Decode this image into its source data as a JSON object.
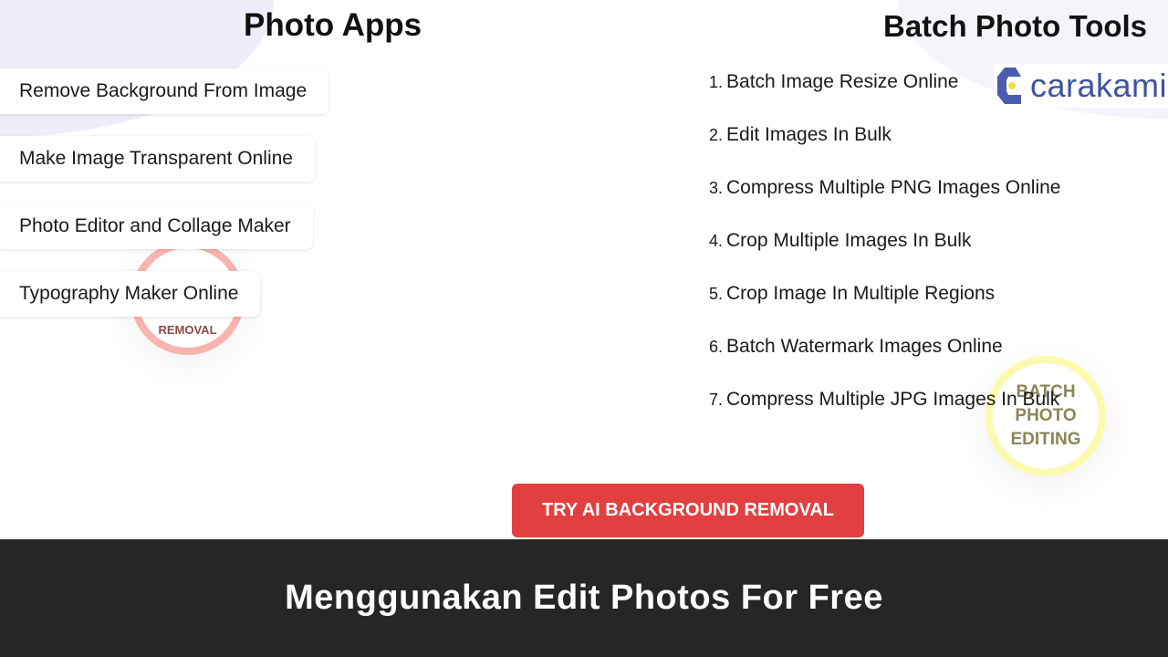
{
  "left": {
    "title": "Photo Apps",
    "items": [
      "Remove Background From Image",
      "Make Image Transparent Online",
      "Photo Editor and Collage Maker",
      "Typography Maker Online"
    ],
    "badge": "REMOVAL"
  },
  "right": {
    "title": "Batch Photo Tools",
    "items": [
      {
        "num": "1.",
        "label": "Batch Image Resize Online"
      },
      {
        "num": "2.",
        "label": "Edit Images In Bulk"
      },
      {
        "num": "3.",
        "label": "Compress Multiple PNG Images Online"
      },
      {
        "num": "4.",
        "label": "Crop Multiple Images In Bulk"
      },
      {
        "num": "5.",
        "label": "Crop Image In Multiple Regions"
      },
      {
        "num": "6.",
        "label": "Batch Watermark Images Online"
      },
      {
        "num": "7.",
        "label": "Compress Multiple JPG Images In Bulk"
      }
    ],
    "badge_lines": [
      "BATCH",
      "PHOTO",
      "EDITING"
    ]
  },
  "logo": {
    "text": "carakami",
    "color": "#3f53a0",
    "accent": "#f2e23a"
  },
  "cta": {
    "label": "TRY AI BACKGROUND REMOVAL",
    "color": "#e24040"
  },
  "banner": {
    "title": "Menggunakan Edit Photos For Free"
  }
}
